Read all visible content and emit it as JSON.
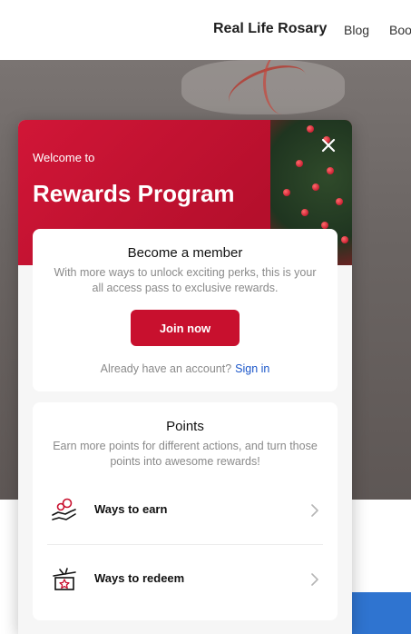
{
  "site": {
    "brand": "Real Life Rosary",
    "nav": [
      "Blog",
      "Boo"
    ]
  },
  "modal": {
    "welcome": "Welcome to",
    "title": "Rewards Program",
    "member_card": {
      "title": "Become a member",
      "description": "With more ways to unlock exciting perks, this is your all access pass to exclusive rewards.",
      "join_label": "Join now",
      "have_account": "Already have an account?",
      "signin_label": "Sign in"
    },
    "points_card": {
      "title": "Points",
      "description": "Earn more points for different actions, and turn those points into awesome rewards!",
      "rows": [
        {
          "label": "Ways to earn",
          "icon": "hand-coins-icon"
        },
        {
          "label": "Ways to redeem",
          "icon": "gift-icon"
        }
      ]
    }
  },
  "colors": {
    "brand_red": "#c8102e",
    "link_blue": "#1a56c9"
  }
}
